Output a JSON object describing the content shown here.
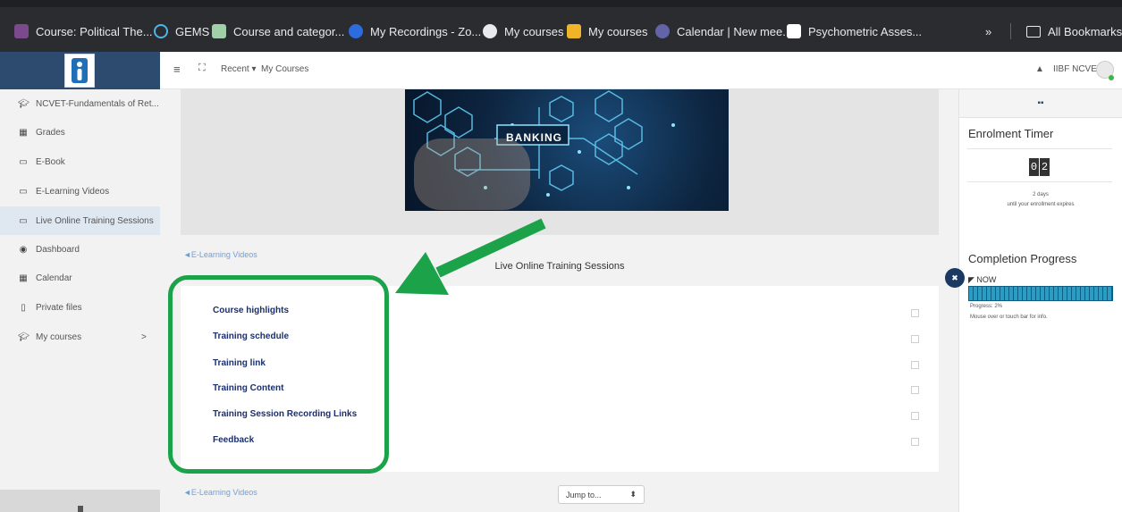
{
  "bookmarks": [
    {
      "label": "Course: Political The..."
    },
    {
      "label": "GEMS"
    },
    {
      "label": "Course and categor..."
    },
    {
      "label": "My Recordings - Zo..."
    },
    {
      "label": "My courses"
    },
    {
      "label": "My courses"
    },
    {
      "label": "Calendar | New mee..."
    },
    {
      "label": "Psychometric Asses..."
    }
  ],
  "bookmarks_more": "»",
  "all_bookmarks": "All Bookmarks",
  "navbar": {
    "recent": "Recent ▾",
    "my_courses": "My Courses",
    "user": "IIBF NCVET"
  },
  "sidebar": {
    "items": [
      {
        "label": "NCVET-Fundamentals of Ret...",
        "icon": "graduation-cap-icon"
      },
      {
        "label": "Grades",
        "icon": "table-icon"
      },
      {
        "label": "E-Book",
        "icon": "folder-icon"
      },
      {
        "label": "E-Learning Videos",
        "icon": "folder-icon"
      },
      {
        "label": "Live Online Training Sessions",
        "icon": "folder-icon"
      },
      {
        "label": "Dashboard",
        "icon": "dashboard-icon"
      },
      {
        "label": "Calendar",
        "icon": "calendar-icon"
      },
      {
        "label": "Private files",
        "icon": "file-icon"
      },
      {
        "label": "My courses",
        "icon": "graduation-cap-icon"
      }
    ],
    "chevron": ">"
  },
  "banner": {
    "text": "BANKING"
  },
  "main": {
    "back_link_top": "◄E-Learning Videos",
    "section_title": "Live Online Training Sessions",
    "activities": [
      {
        "label": "Course highlights"
      },
      {
        "label": "Training schedule"
      },
      {
        "label": "Training link"
      },
      {
        "label": "Training Content"
      },
      {
        "label": "Training Session Recording Links"
      },
      {
        "label": "Feedback"
      }
    ],
    "back_link_bottom": "◄E-Learning Videos",
    "jump_to": "Jump to...",
    "jump_arrow": "⬍"
  },
  "right_panel": {
    "enrolment_title": "Enrolment Timer",
    "timer_digits": [
      "0",
      "2"
    ],
    "days_text": "2 days",
    "expires_text": "until your enrollment expires",
    "completion_title": "Completion Progress",
    "now_label": "NOW",
    "progress_text": "Progress: 2%",
    "progress_value": 2,
    "hint_text": "Mouse over or touch bar for info."
  },
  "colors": {
    "accent": "#2c4b6e",
    "annotation_green": "#1ca34a",
    "progress": "#1d8fb5"
  }
}
